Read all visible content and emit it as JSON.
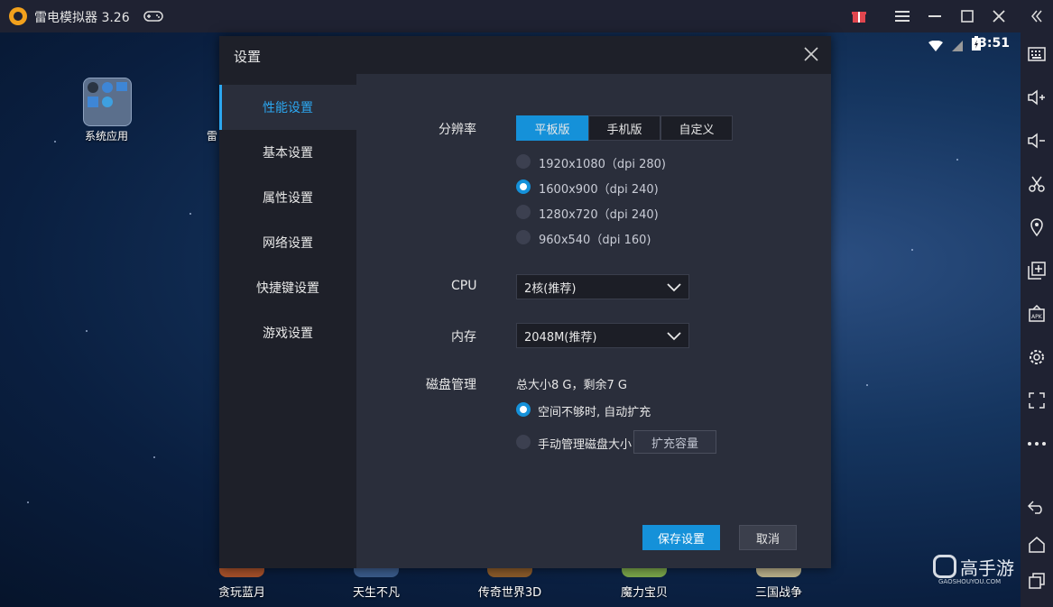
{
  "titlebar": {
    "app_title": "雷电模拟器 3.26",
    "buttons": [
      "gift-icon",
      "menu-icon",
      "minimize-icon",
      "maximize-icon",
      "close-icon",
      "collapse-icon"
    ]
  },
  "statusbar": {
    "time": "3:51"
  },
  "desktop": {
    "system_app_label": "系统应用",
    "partial_label": "雷",
    "dock": [
      {
        "label": "贪玩蓝月"
      },
      {
        "label": "天生不凡"
      },
      {
        "label": "传奇世界3D"
      },
      {
        "label": "魔力宝贝"
      },
      {
        "label": "三国战争"
      }
    ],
    "watermark": "高手游",
    "watermark_sub": "GAOSHOUYOU.COM"
  },
  "sidebar": {
    "icons": [
      "keyboard-icon",
      "volume-up-icon",
      "volume-down-icon",
      "scissors-icon",
      "location-icon",
      "add-window-icon",
      "apk-icon",
      "settings-icon",
      "fullscreen-icon",
      "more-icon",
      "back-icon",
      "home-icon",
      "recent-apps-icon"
    ]
  },
  "dialog": {
    "title": "设置",
    "nav": [
      {
        "label": "性能设置",
        "active": true
      },
      {
        "label": "基本设置",
        "active": false
      },
      {
        "label": "属性设置",
        "active": false
      },
      {
        "label": "网络设置",
        "active": false
      },
      {
        "label": "快捷键设置",
        "active": false
      },
      {
        "label": "游戏设置",
        "active": false
      }
    ],
    "resolution": {
      "label": "分辨率",
      "tabs": [
        "平板版",
        "手机版",
        "自定义"
      ],
      "selected_tab": "平板版",
      "options": [
        {
          "label": "1920x1080（dpi 280)",
          "selected": false
        },
        {
          "label": "1600x900（dpi 240)",
          "selected": true
        },
        {
          "label": "1280x720（dpi 240)",
          "selected": false
        },
        {
          "label": "960x540（dpi 160)",
          "selected": false
        }
      ]
    },
    "cpu": {
      "label": "CPU",
      "value": "2核(推荐)"
    },
    "memory": {
      "label": "内存",
      "value": "2048M(推荐)"
    },
    "disk": {
      "label": "磁盘管理",
      "summary": "总大小8 G，剩余7 G",
      "auto_expand_label": "空间不够时, 自动扩充",
      "auto_expand_selected": true,
      "manual_label": "手动管理磁盘大小",
      "manual_selected": false,
      "expand_button": "扩充容量"
    },
    "save_button": "保存设置",
    "cancel_button": "取消"
  },
  "colors": {
    "accent": "#1591d9",
    "dialog_bg": "#2a2e3b",
    "titlebar_bg": "#1f2232"
  }
}
